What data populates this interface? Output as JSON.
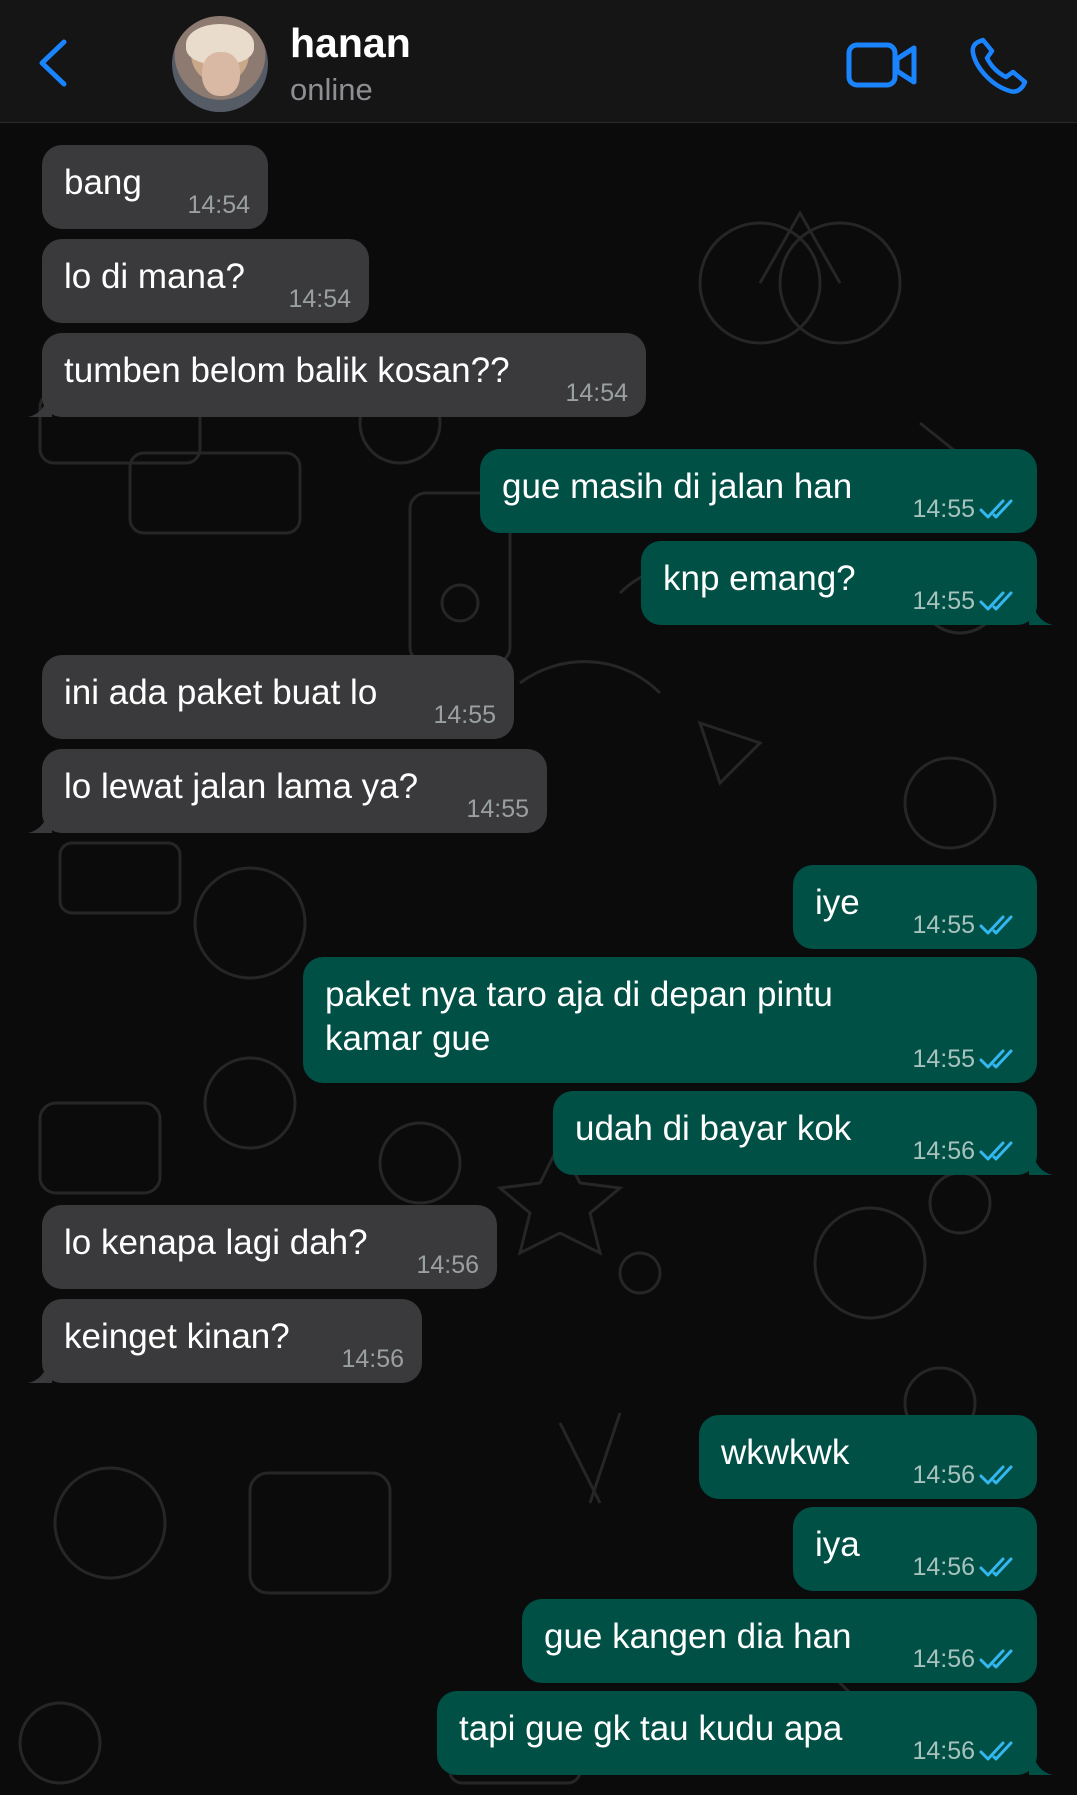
{
  "header": {
    "contact_name": "hanan",
    "status": "online"
  },
  "colors": {
    "header_bg": "#151515",
    "chat_bg": "#0b0b0b",
    "incoming_bubble": "#3a3a3c",
    "outgoing_bubble": "#005046",
    "accent": "#1a84ff",
    "read_ticks": "#34b7f1"
  },
  "icons": {
    "back": "chevron-left-icon",
    "video": "video-camera-icon",
    "call": "phone-icon",
    "read_receipt": "double-check-icon"
  },
  "messages": [
    {
      "text": "bang",
      "time": "14:54",
      "direction": "in"
    },
    {
      "text": "lo di mana?",
      "time": "14:54",
      "direction": "in"
    },
    {
      "text": "tumben belom balik kosan??",
      "time": "14:54",
      "direction": "in"
    },
    {
      "text": "gue masih di jalan han",
      "time": "14:55",
      "direction": "out"
    },
    {
      "text": "knp emang?",
      "time": "14:55",
      "direction": "out"
    },
    {
      "text": "ini ada paket buat lo",
      "time": "14:55",
      "direction": "in"
    },
    {
      "text": "lo lewat jalan lama ya?",
      "time": "14:55",
      "direction": "in"
    },
    {
      "text": "iye",
      "time": "14:55",
      "direction": "out"
    },
    {
      "text": "paket nya taro aja di depan pintu kamar gue",
      "time": "14:55",
      "direction": "out"
    },
    {
      "text": "udah di bayar kok",
      "time": "14:56",
      "direction": "out"
    },
    {
      "text": "lo kenapa lagi dah?",
      "time": "14:56",
      "direction": "in"
    },
    {
      "text": "keinget kinan?",
      "time": "14:56",
      "direction": "in"
    },
    {
      "text": "wkwkwk",
      "time": "14:56",
      "direction": "out"
    },
    {
      "text": "iya",
      "time": "14:56",
      "direction": "out"
    },
    {
      "text": "gue kangen dia han",
      "time": "14:56",
      "direction": "out"
    },
    {
      "text": "tapi gue gk tau kudu apa",
      "time": "14:56",
      "direction": "out"
    }
  ]
}
